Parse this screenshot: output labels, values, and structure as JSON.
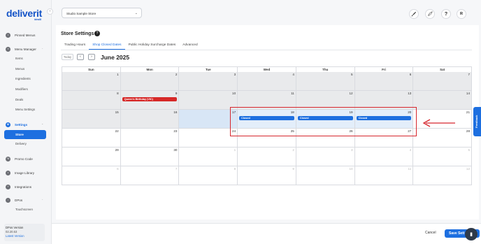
{
  "brand": {
    "name": "deliverit",
    "sub": "ideal8"
  },
  "sidebar": {
    "items": [
      {
        "label": "Pinned Menus",
        "icon": "pin-icon"
      },
      {
        "label": "Menu Manager",
        "icon": "menu-icon"
      },
      {
        "label": "Promo Code",
        "icon": "ticket-icon"
      },
      {
        "label": "Image Library",
        "icon": "image-icon"
      },
      {
        "label": "Integrations",
        "icon": "plug-icon"
      },
      {
        "label": "DPos",
        "icon": "pos-icon"
      }
    ],
    "menu_manager_sub": [
      "Items",
      "Menus",
      "Ingredients",
      "Modifiers",
      "Deals",
      "Menu Settings"
    ],
    "settings": {
      "label": "Settings",
      "icon": "gear-icon"
    },
    "settings_sub": [
      "Store",
      "Delivery"
    ],
    "dpos_sub": [
      "Touchscreen"
    ],
    "version": {
      "title": "DPos Version",
      "number": "02.20.53",
      "link": "Latest Version"
    }
  },
  "header": {
    "store_select": "Studio Sample Store",
    "avatar_initial": "R",
    "help_symbol": "?"
  },
  "main": {
    "title": "Store Settings",
    "help_symbol": "?",
    "tabs": [
      "Trading Hours",
      "Shop Closed Dates",
      "Public Holiday Surcharge Dates",
      "Advanced"
    ],
    "active_tab": 1,
    "today_label": "Today",
    "prev_symbol": "‹",
    "next_symbol": "›",
    "month": "June 2025",
    "weekdays": [
      "Sun",
      "Mon",
      "Tue",
      "Wed",
      "Thu",
      "Fri",
      "Sat"
    ],
    "weeks": [
      [
        {
          "n": "1",
          "state": "past"
        },
        {
          "n": "2",
          "state": "past"
        },
        {
          "n": "3",
          "state": "past"
        },
        {
          "n": "4",
          "state": "past"
        },
        {
          "n": "5",
          "state": "past"
        },
        {
          "n": "6",
          "state": "past"
        },
        {
          "n": "7",
          "state": "past"
        }
      ],
      [
        {
          "n": "8",
          "state": "past"
        },
        {
          "n": "9",
          "state": "past",
          "event": "Queen's Birthday (VIC)",
          "event_color": "red"
        },
        {
          "n": "10",
          "state": "past"
        },
        {
          "n": "11",
          "state": "past"
        },
        {
          "n": "12",
          "state": "past"
        },
        {
          "n": "13",
          "state": "past"
        },
        {
          "n": "14",
          "state": "past"
        }
      ],
      [
        {
          "n": "15",
          "state": "past"
        },
        {
          "n": "16",
          "state": "past"
        },
        {
          "n": "17",
          "state": "today"
        },
        {
          "n": "18",
          "state": "selected",
          "event": "Closed",
          "event_color": "blue"
        },
        {
          "n": "19",
          "state": "selected",
          "event": "Closed",
          "event_color": "blue"
        },
        {
          "n": "20",
          "state": "selected",
          "event": "Closed",
          "event_color": "blue"
        },
        {
          "n": "21",
          "state": "normal"
        }
      ],
      [
        {
          "n": "22",
          "state": "normal"
        },
        {
          "n": "23",
          "state": "normal"
        },
        {
          "n": "24",
          "state": "normal"
        },
        {
          "n": "25",
          "state": "normal"
        },
        {
          "n": "26",
          "state": "normal"
        },
        {
          "n": "27",
          "state": "normal"
        },
        {
          "n": "28",
          "state": "normal"
        }
      ],
      [
        {
          "n": "29",
          "state": "normal"
        },
        {
          "n": "30",
          "state": "normal"
        },
        {
          "n": "1",
          "state": "other"
        },
        {
          "n": "2",
          "state": "other"
        },
        {
          "n": "3",
          "state": "other"
        },
        {
          "n": "4",
          "state": "other"
        },
        {
          "n": "5",
          "state": "other"
        }
      ],
      [
        {
          "n": "6",
          "state": "other"
        },
        {
          "n": "7",
          "state": "other"
        },
        {
          "n": "8",
          "state": "other"
        },
        {
          "n": "9",
          "state": "other"
        },
        {
          "n": "10",
          "state": "other"
        },
        {
          "n": "11",
          "state": "other"
        },
        {
          "n": "12",
          "state": "other"
        }
      ]
    ]
  },
  "footer": {
    "cancel_label": "Cancel",
    "save_label": "Save Sett"
  },
  "feedback": {
    "label": "Feedback"
  },
  "colors": {
    "accent": "#1d6fe0",
    "holiday": "#d62828",
    "highlight": "#d6262d"
  }
}
